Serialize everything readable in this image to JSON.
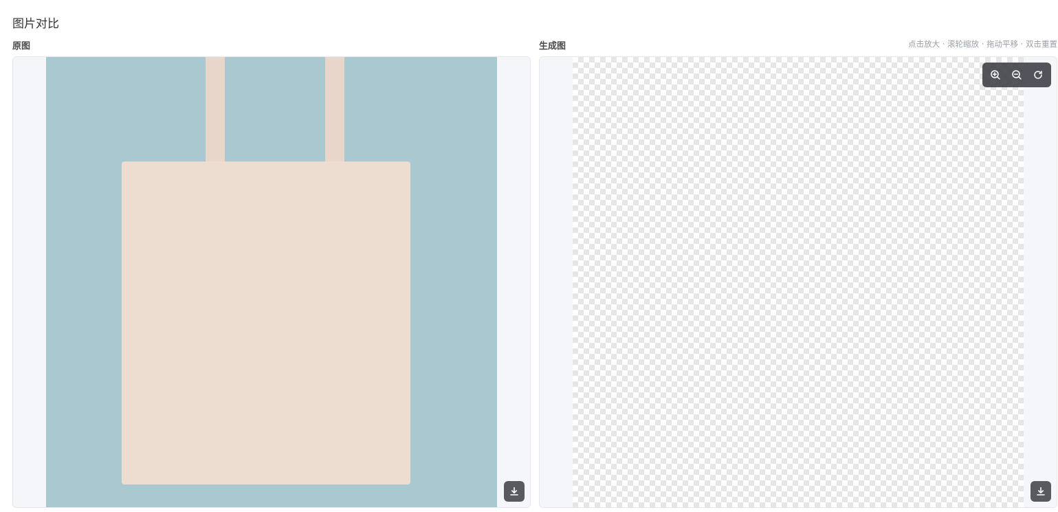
{
  "page": {
    "title": "图片对比"
  },
  "original": {
    "label": "原图",
    "download_icon": "download-icon"
  },
  "generated": {
    "label": "生成图",
    "hint": "点击放大 · 滚轮缩放 · 拖动平移 · 双击重置",
    "toolbar": {
      "zoom_in_icon": "zoom-in-icon",
      "zoom_out_icon": "zoom-out-icon",
      "reset_icon": "reset-icon"
    },
    "download_icon": "download-icon"
  },
  "colors": {
    "toolbar_bg": "#3c3e44",
    "panel_bg": "#f5f6fa",
    "hint_text": "#9aa0a8"
  }
}
